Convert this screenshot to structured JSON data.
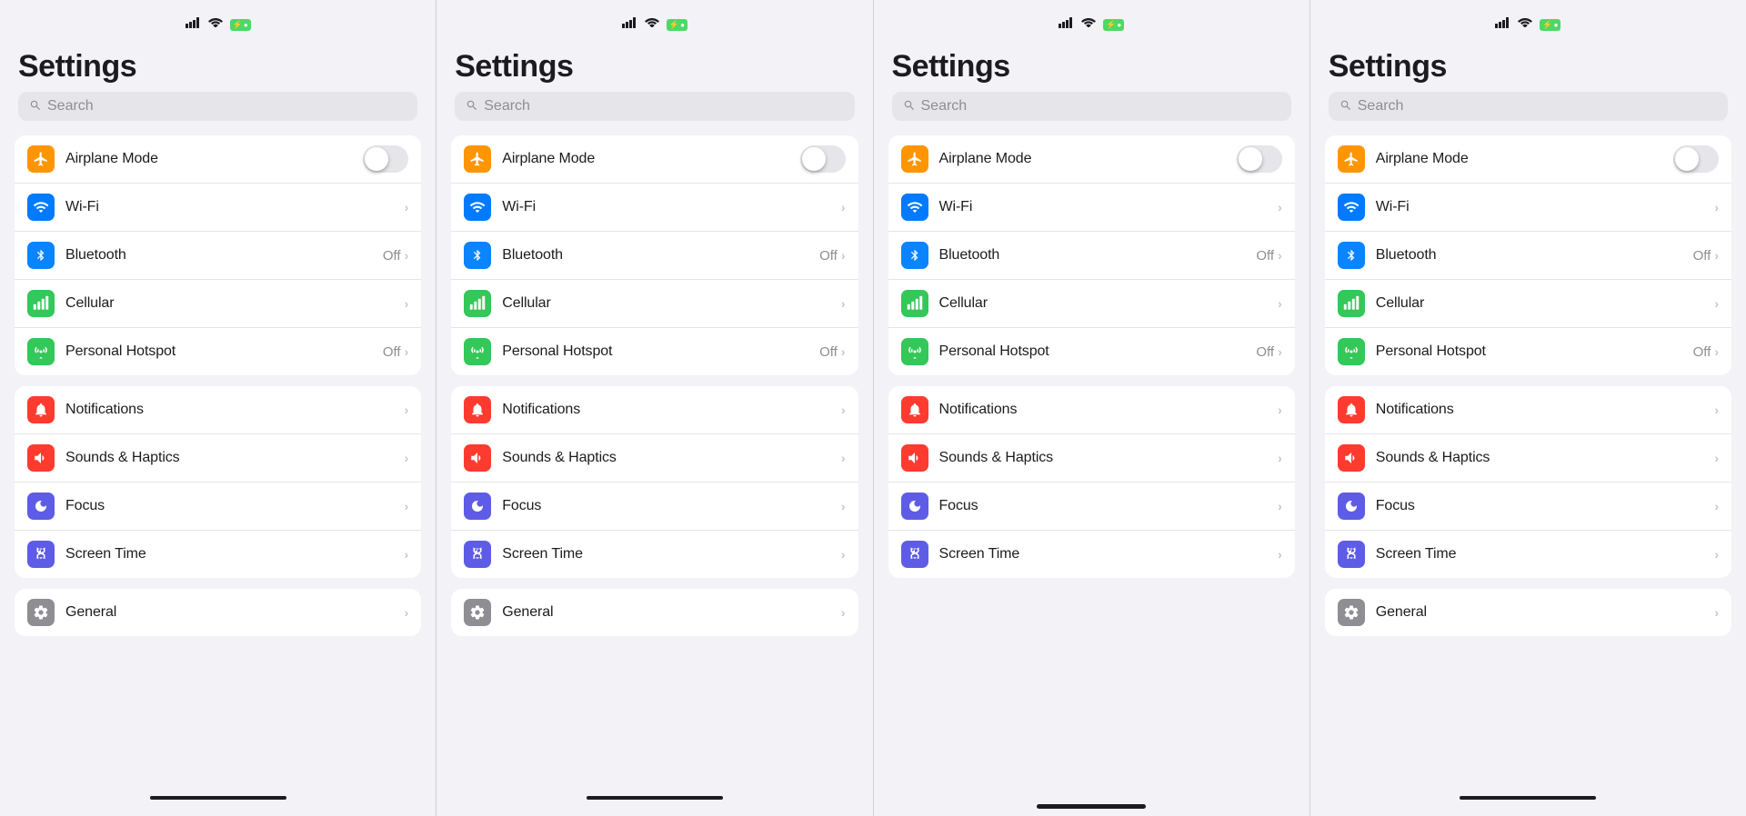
{
  "screens": [
    {
      "id": "screen1",
      "title": "Settings",
      "search_placeholder": "Search",
      "show_bottom_line": true,
      "groups": [
        {
          "id": "connectivity",
          "rows": [
            {
              "id": "airplane",
              "icon": "✈",
              "icon_color": "icon-orange",
              "label": "Airplane Mode",
              "type": "toggle"
            },
            {
              "id": "wifi",
              "icon": "📶",
              "icon_color": "icon-blue2",
              "label": "Wi-Fi",
              "type": "chevron"
            },
            {
              "id": "bluetooth",
              "icon": "❋",
              "icon_color": "icon-blue-dark",
              "label": "Bluetooth",
              "value": "Off",
              "type": "value-chevron"
            },
            {
              "id": "cellular",
              "icon": "📡",
              "icon_color": "icon-green",
              "label": "Cellular",
              "type": "chevron"
            },
            {
              "id": "hotspot",
              "icon": "⊕",
              "icon_color": "icon-green",
              "label": "Personal Hotspot",
              "value": "Off",
              "type": "value-chevron"
            }
          ]
        },
        {
          "id": "notifications",
          "rows": [
            {
              "id": "notifications",
              "icon": "🔔",
              "icon_color": "icon-red2",
              "label": "Notifications",
              "type": "chevron"
            },
            {
              "id": "sounds",
              "icon": "🔊",
              "icon_color": "icon-red2",
              "label": "Sounds & Haptics",
              "type": "chevron"
            },
            {
              "id": "focus",
              "icon": "☾",
              "icon_color": "icon-indigo",
              "label": "Focus",
              "type": "chevron"
            },
            {
              "id": "screentime",
              "icon": "⧗",
              "icon_color": "icon-indigo",
              "label": "Screen Time",
              "type": "chevron"
            }
          ]
        },
        {
          "id": "general",
          "rows": [
            {
              "id": "general",
              "icon": "⚙",
              "icon_color": "icon-gray",
              "label": "General",
              "type": "chevron"
            }
          ]
        }
      ]
    },
    {
      "id": "screen2",
      "title": "Settings",
      "search_placeholder": "Search",
      "show_bottom_line": true,
      "groups": [
        {
          "id": "connectivity",
          "rows": [
            {
              "id": "airplane",
              "icon": "✈",
              "icon_color": "icon-orange",
              "label": "Airplane Mode",
              "type": "toggle"
            },
            {
              "id": "wifi",
              "icon": "📶",
              "icon_color": "icon-blue2",
              "label": "Wi-Fi",
              "type": "chevron"
            },
            {
              "id": "bluetooth",
              "icon": "❋",
              "icon_color": "icon-blue-dark",
              "label": "Bluetooth",
              "value": "Off",
              "type": "value-chevron"
            },
            {
              "id": "cellular",
              "icon": "📡",
              "icon_color": "icon-green",
              "label": "Cellular",
              "type": "chevron"
            },
            {
              "id": "hotspot",
              "icon": "⊕",
              "icon_color": "icon-green",
              "label": "Personal Hotspot",
              "value": "Off",
              "type": "value-chevron"
            }
          ]
        },
        {
          "id": "notifications",
          "rows": [
            {
              "id": "notifications",
              "icon": "🔔",
              "icon_color": "icon-red2",
              "label": "Notifications",
              "type": "chevron"
            },
            {
              "id": "sounds",
              "icon": "🔊",
              "icon_color": "icon-red2",
              "label": "Sounds & Haptics",
              "type": "chevron"
            },
            {
              "id": "focus",
              "icon": "☾",
              "icon_color": "icon-indigo",
              "label": "Focus",
              "type": "chevron"
            },
            {
              "id": "screentime",
              "icon": "⧗",
              "icon_color": "icon-indigo",
              "label": "Screen Time",
              "type": "chevron"
            }
          ]
        },
        {
          "id": "general",
          "rows": [
            {
              "id": "general",
              "icon": "⚙",
              "icon_color": "icon-gray",
              "label": "General",
              "type": "chevron"
            }
          ]
        }
      ]
    },
    {
      "id": "screen3",
      "title": "Settings",
      "search_placeholder": "Search",
      "show_home_indicator": true,
      "groups": [
        {
          "id": "connectivity",
          "rows": [
            {
              "id": "airplane",
              "icon": "✈",
              "icon_color": "icon-orange",
              "label": "Airplane Mode",
              "type": "toggle"
            },
            {
              "id": "wifi",
              "icon": "📶",
              "icon_color": "icon-blue2",
              "label": "Wi-Fi",
              "type": "chevron"
            },
            {
              "id": "bluetooth",
              "icon": "❋",
              "icon_color": "icon-blue-dark",
              "label": "Bluetooth",
              "value": "Off",
              "type": "value-chevron"
            },
            {
              "id": "cellular",
              "icon": "📡",
              "icon_color": "icon-green",
              "label": "Cellular",
              "type": "chevron"
            },
            {
              "id": "hotspot",
              "icon": "⊕",
              "icon_color": "icon-green",
              "label": "Personal Hotspot",
              "value": "Off",
              "type": "value-chevron"
            }
          ]
        },
        {
          "id": "notifications",
          "rows": [
            {
              "id": "notifications",
              "icon": "🔔",
              "icon_color": "icon-red2",
              "label": "Notifications",
              "type": "chevron"
            },
            {
              "id": "sounds",
              "icon": "🔊",
              "icon_color": "icon-red2",
              "label": "Sounds & Haptics",
              "type": "chevron"
            },
            {
              "id": "focus",
              "icon": "☾",
              "icon_color": "icon-indigo",
              "label": "Focus",
              "type": "chevron"
            },
            {
              "id": "screentime",
              "icon": "⧗",
              "icon_color": "icon-indigo",
              "label": "Screen Time",
              "type": "chevron"
            }
          ]
        }
      ]
    },
    {
      "id": "screen4",
      "title": "Settings",
      "search_placeholder": "Search",
      "show_bottom_line": true,
      "groups": [
        {
          "id": "connectivity",
          "rows": [
            {
              "id": "airplane",
              "icon": "✈",
              "icon_color": "icon-orange",
              "label": "Airplane Mode",
              "type": "toggle"
            },
            {
              "id": "wifi",
              "icon": "📶",
              "icon_color": "icon-blue2",
              "label": "Wi-Fi",
              "type": "chevron"
            },
            {
              "id": "bluetooth",
              "icon": "❋",
              "icon_color": "icon-blue-dark",
              "label": "Bluetooth",
              "value": "Off",
              "type": "value-chevron"
            },
            {
              "id": "cellular",
              "icon": "📡",
              "icon_color": "icon-green",
              "label": "Cellular",
              "type": "chevron"
            },
            {
              "id": "hotspot",
              "icon": "⊕",
              "icon_color": "icon-green",
              "label": "Personal Hotspot",
              "value": "Off",
              "type": "value-chevron"
            }
          ]
        },
        {
          "id": "notifications",
          "rows": [
            {
              "id": "notifications",
              "icon": "🔔",
              "icon_color": "icon-red2",
              "label": "Notifications",
              "type": "chevron"
            },
            {
              "id": "sounds",
              "icon": "🔊",
              "icon_color": "icon-red2",
              "label": "Sounds & Haptics",
              "type": "chevron"
            },
            {
              "id": "focus",
              "icon": "☾",
              "icon_color": "icon-indigo",
              "label": "Focus",
              "type": "chevron"
            },
            {
              "id": "screentime",
              "icon": "⧗",
              "icon_color": "icon-indigo",
              "label": "Screen Time",
              "type": "chevron"
            }
          ]
        },
        {
          "id": "general",
          "rows": [
            {
              "id": "general",
              "icon": "⚙",
              "icon_color": "icon-gray",
              "label": "General",
              "type": "chevron"
            }
          ]
        }
      ]
    }
  ],
  "icons": {
    "airplane": "✈",
    "wifi": "wifi",
    "bluetooth": "bluetooth",
    "cellular": "cellular",
    "hotspot": "hotspot",
    "notifications": "bell",
    "sounds": "speaker",
    "focus": "moon",
    "screentime": "hourglass",
    "general": "gear",
    "search": "🔍",
    "chevron": "›",
    "signal_bars": "●●●",
    "wifi_sym": "▲",
    "battery_sym": "⚡"
  }
}
